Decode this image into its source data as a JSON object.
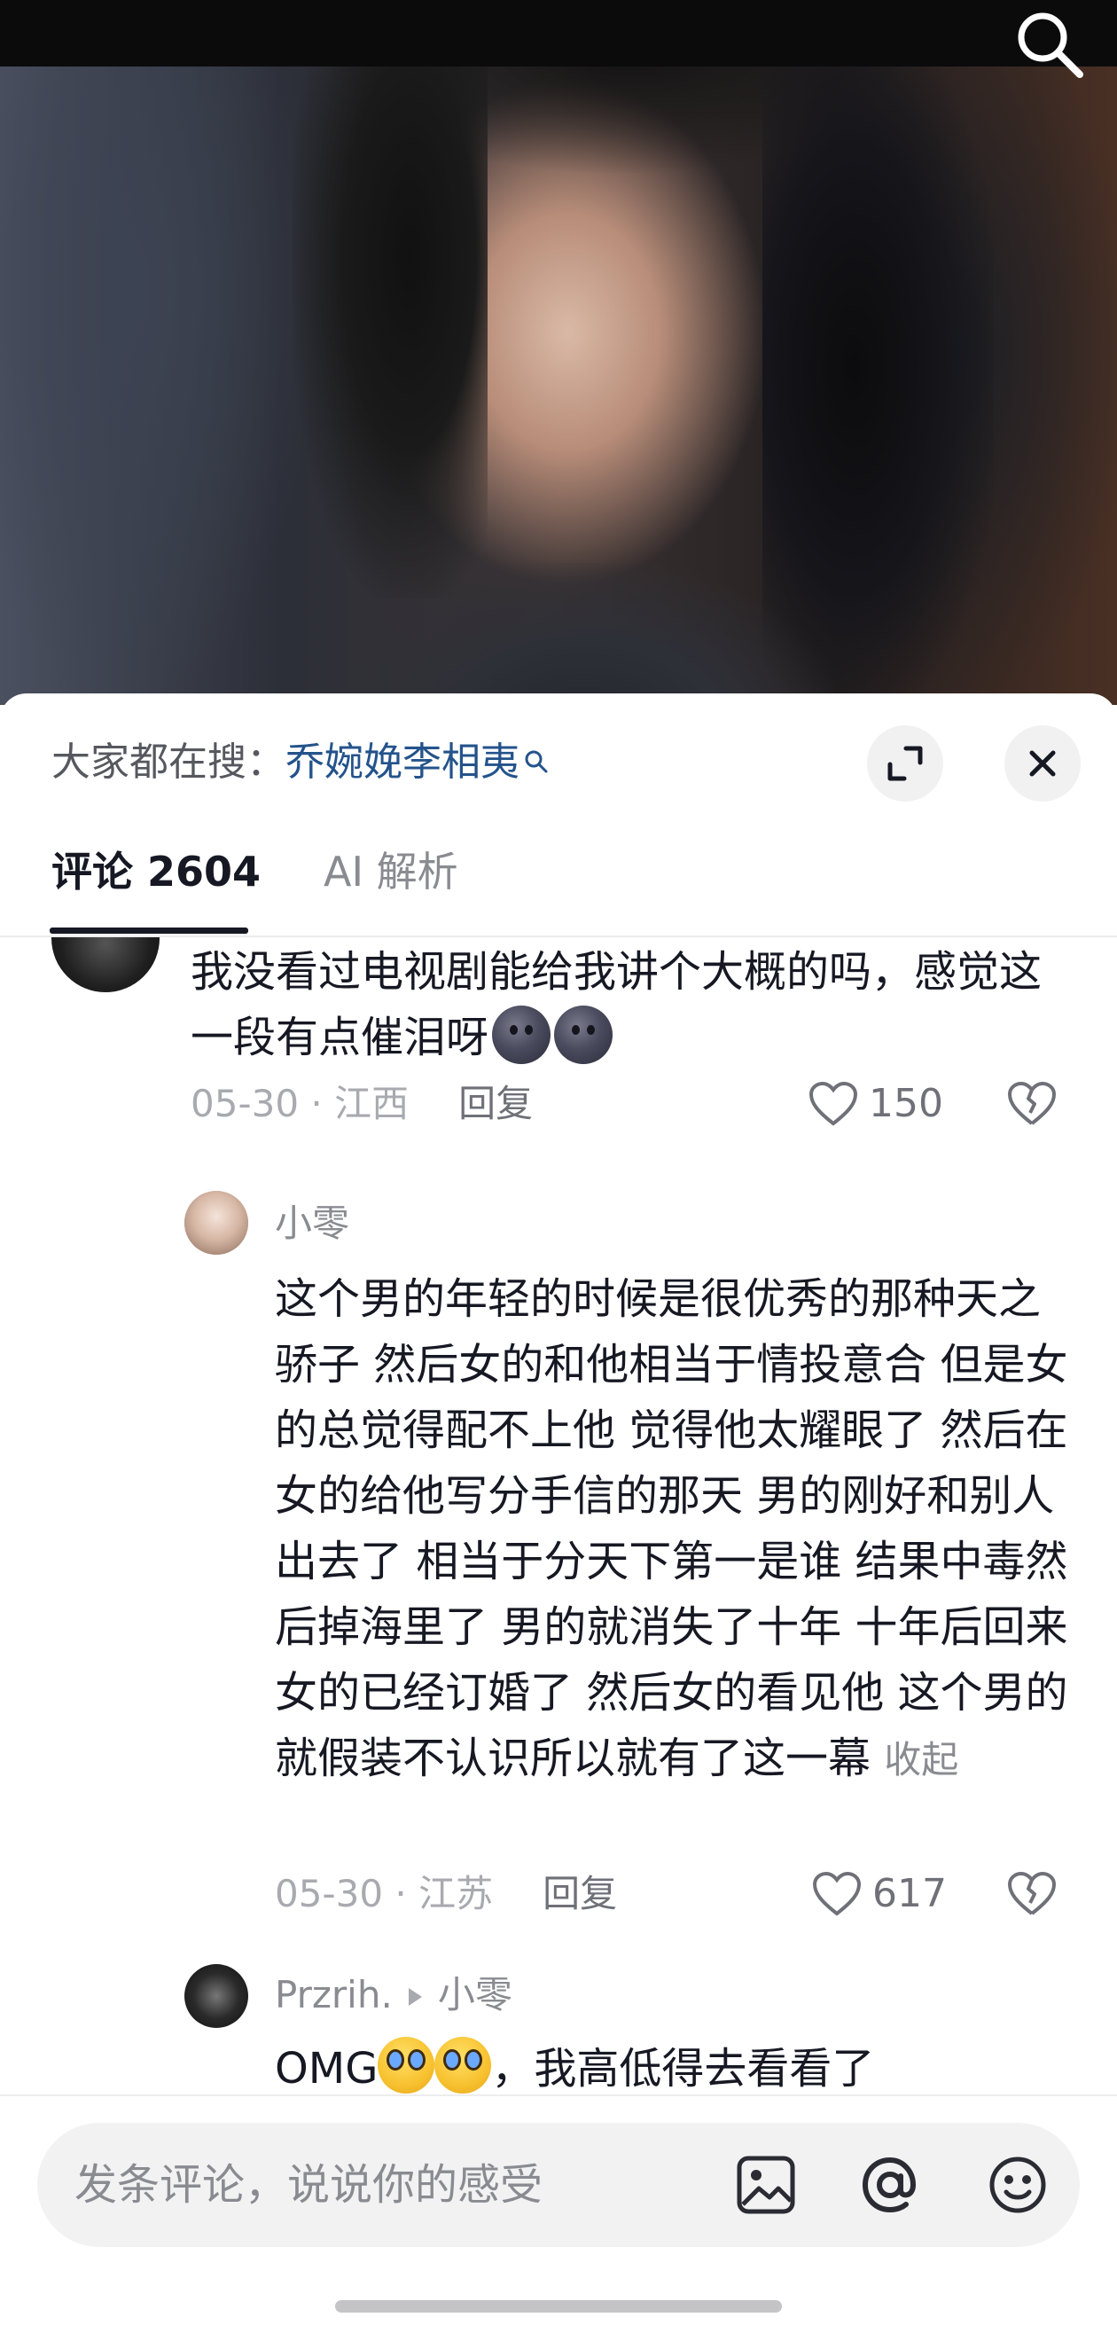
{
  "video": {
    "search_icon": "search-icon"
  },
  "sheet": {
    "trending_prefix": "大家都在搜：",
    "trending_keyword": "乔婉娩李相夷",
    "expand_icon": "expand-icon",
    "close_icon": "close-icon"
  },
  "tabs": [
    {
      "label": "评论 2604",
      "active": true
    },
    {
      "label": "AI 解析",
      "active": false
    }
  ],
  "comments": [
    {
      "text": "我没看过电视剧能给我讲个大概的吗，感觉这一段有点催泪呀",
      "emoji": [
        "dark-moon-face-emoji",
        "dark-moon-face-emoji"
      ],
      "date": "05-30",
      "location": "江西",
      "reply_label": "回复",
      "likes": "150"
    }
  ],
  "replies": [
    {
      "username": "小零",
      "text": "这个男的年轻的时候是很优秀的那种天之骄子 然后女的和他相当于情投意合 但是女的总觉得配不上他 觉得他太耀眼了 然后在女的给他写分手信的那天 男的刚好和别人出去了 相当于分天下第一是谁 结果中毒然后掉海里了 男的就消失了十年 十年后回来 女的已经订婚了 然后女的看见他 这个男的就假装不认识所以就有了这一幕",
      "collapse_label": "收起",
      "date": "05-30",
      "location": "江苏",
      "reply_label": "回复",
      "likes": "617"
    },
    {
      "username": "Przrih.",
      "reply_to": "小零",
      "text_prefix": "OMG",
      "text_suffix": "，我高低得去看看了",
      "emoji": [
        "crying-face-emoji",
        "crying-face-emoji"
      ]
    }
  ],
  "bottom_bar": {
    "placeholder": "发条评论，说说你的感受",
    "icons": [
      "image-icon",
      "at-icon",
      "emoji-icon"
    ]
  },
  "colors": {
    "keyword_blue": "#24538b",
    "text_primary": "#161823",
    "text_secondary": "#8a8b91",
    "meta_gray": "#a9aab0"
  }
}
